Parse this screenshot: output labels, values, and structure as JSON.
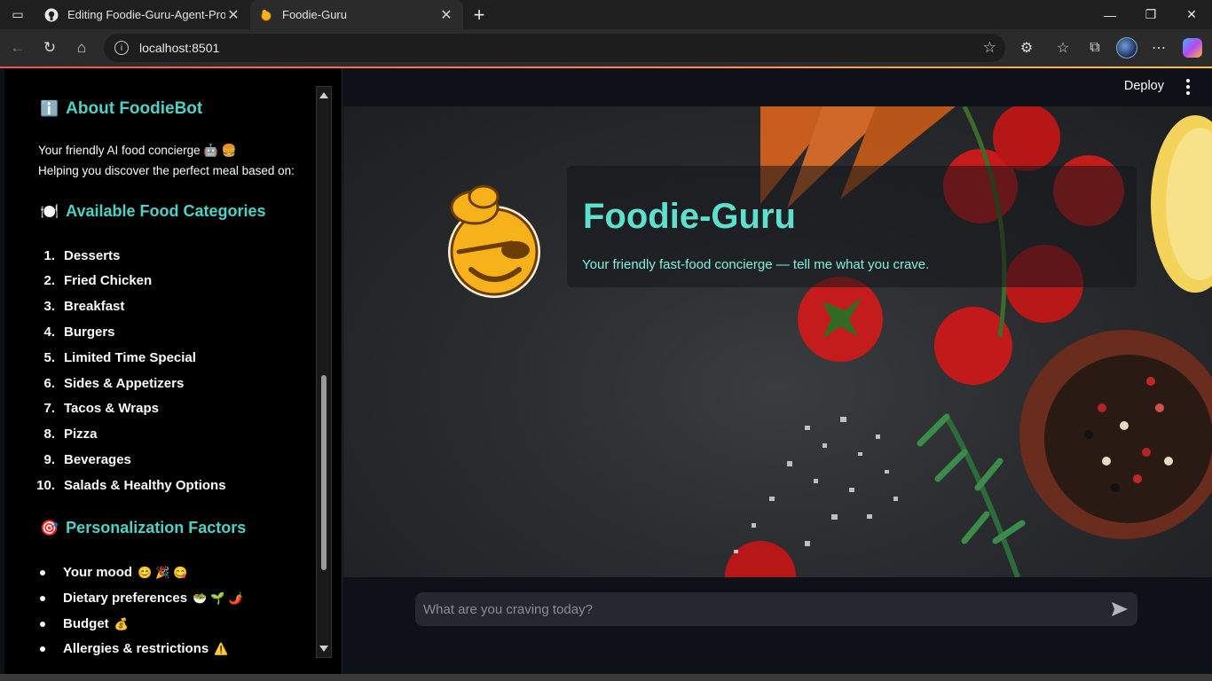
{
  "browser": {
    "tabs": [
      {
        "title": "Editing Foodie-Guru-Agent-Proje",
        "icon": "github-icon",
        "active": false
      },
      {
        "title": "Foodie-Guru",
        "icon": "chef-favicon",
        "active": true
      }
    ],
    "url": "localhost:8501"
  },
  "sidebar": {
    "about": {
      "emoji": "ℹ️",
      "heading": "About FoodieBot"
    },
    "intro_line1": "Your friendly AI food concierge 🤖 🍔",
    "intro_line2": "Helping you discover the perfect meal based on:",
    "categories": {
      "emoji": "🍽️",
      "heading": "Available Food Categories"
    },
    "category_items": [
      {
        "num": "1.",
        "label": "Desserts"
      },
      {
        "num": "2.",
        "label": "Fried Chicken"
      },
      {
        "num": "3.",
        "label": "Breakfast"
      },
      {
        "num": "4.",
        "label": "Burgers"
      },
      {
        "num": "5.",
        "label": "Limited Time Special"
      },
      {
        "num": "6.",
        "label": "Sides & Appetizers"
      },
      {
        "num": "7.",
        "label": "Tacos & Wraps"
      },
      {
        "num": "8.",
        "label": "Pizza"
      },
      {
        "num": "9.",
        "label": "Beverages"
      },
      {
        "num": "10.",
        "label": "Salads & Healthy Options"
      }
    ],
    "personalization": {
      "emoji": "🎯",
      "heading": "Personalization Factors"
    },
    "factor_items": [
      {
        "label": "Your mood",
        "emojis": "😊🎉😋"
      },
      {
        "label": "Dietary preferences",
        "emojis": "🥗🌱🌶️"
      },
      {
        "label": "Budget",
        "emojis": "💰"
      },
      {
        "label": "Allergies & restrictions",
        "emojis": "⚠️"
      }
    ]
  },
  "header": {
    "deploy_label": "Deploy"
  },
  "hero": {
    "title": "Foodie-Guru",
    "subtitle": "Your friendly fast-food concierge — tell me what you crave."
  },
  "chat": {
    "placeholder": "What are you craving today?"
  },
  "colors": {
    "accent": "#4fd1c5",
    "title": "#5ee0cf",
    "background": "#0e1117",
    "sidebar": "#000000"
  }
}
